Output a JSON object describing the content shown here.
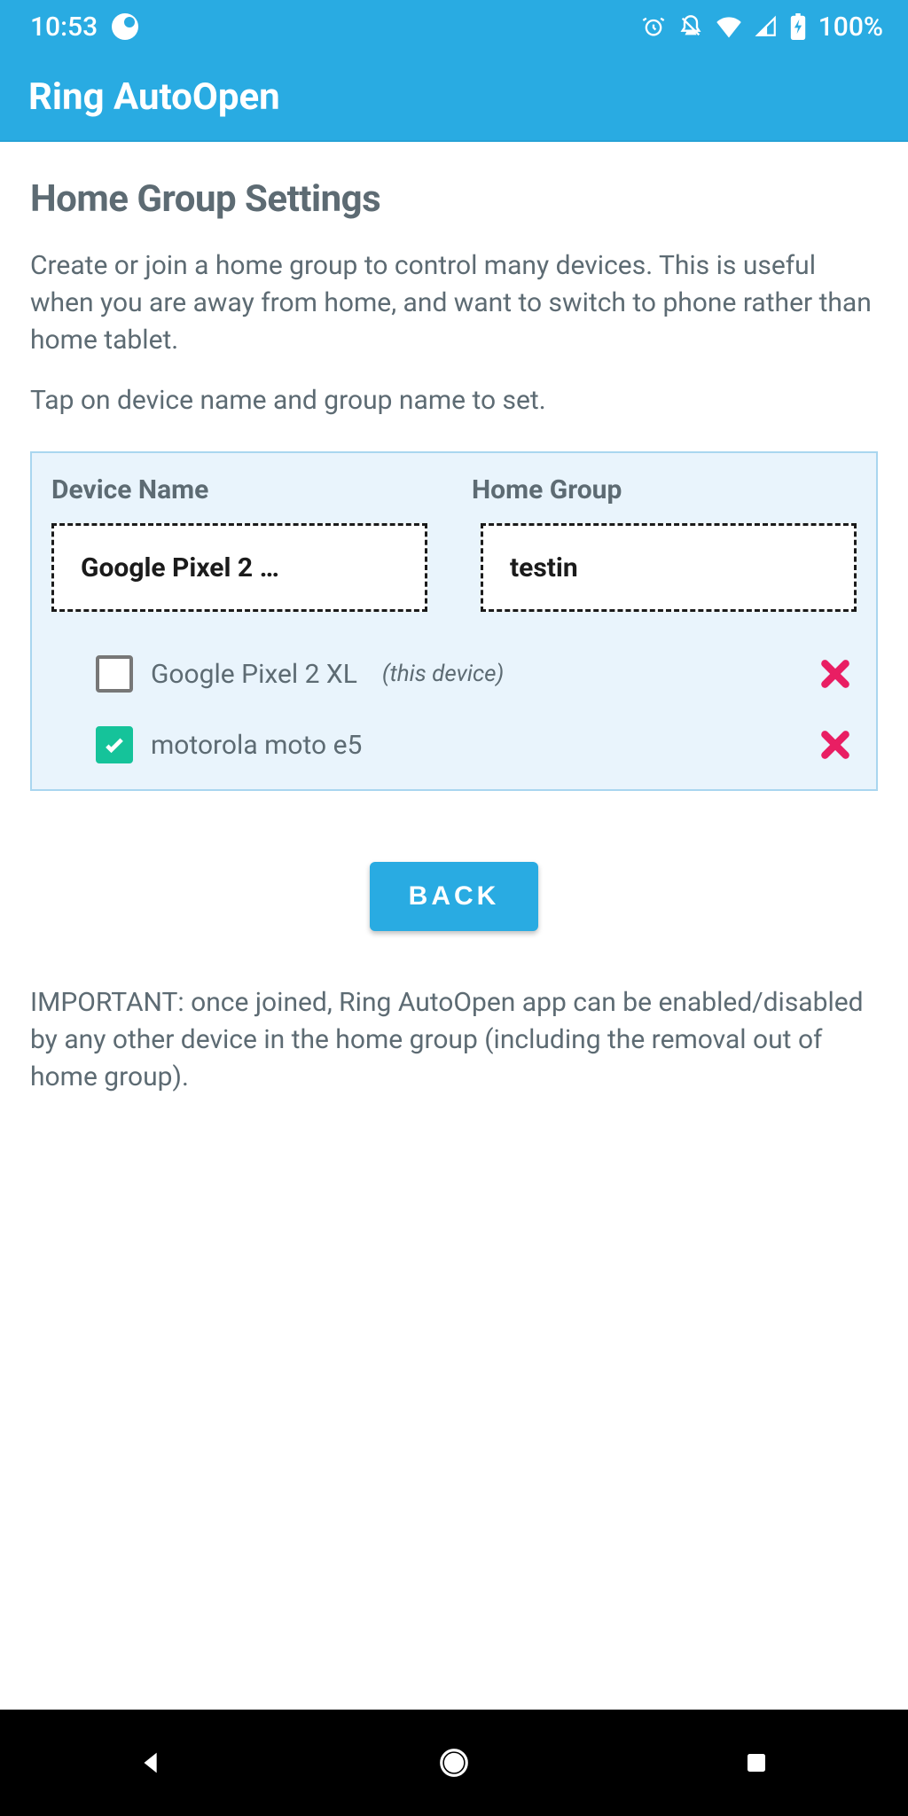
{
  "status": {
    "time": "10:53",
    "battery_text": "100%"
  },
  "appbar": {
    "title": "Ring AutoOpen"
  },
  "page": {
    "title": "Home Group Settings",
    "intro": "Create or join a home group to control many devices. This is useful when you are away from home, and want to switch to phone rather than home tablet.",
    "tap_hint": "Tap on device name and group name to set."
  },
  "card": {
    "device_label": "Device Name",
    "group_label": "Home Group",
    "device_value": "Google Pixel 2 …",
    "group_value": "testin",
    "devices": [
      {
        "name": "Google Pixel 2 XL",
        "hint": "(this device)",
        "checked": false
      },
      {
        "name": "motorola moto e5",
        "hint": "",
        "checked": true
      }
    ]
  },
  "back_label": "BACK",
  "important": "IMPORTANT: once joined, Ring AutoOpen app can be enabled/disabled by any other device in the home group (including the removal out of home group).",
  "colors": {
    "brand": "#29abe2",
    "accent_green": "#15c39a",
    "danger": "#e91e63"
  }
}
